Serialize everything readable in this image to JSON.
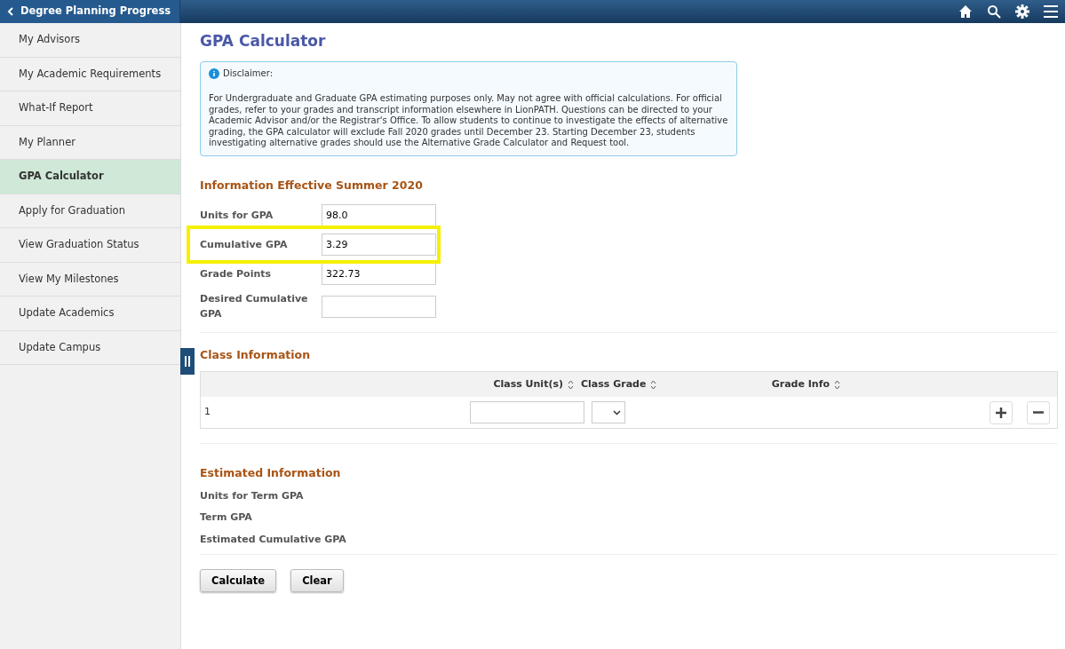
{
  "header": {
    "back_label": "Degree Planning Progress"
  },
  "sidebar": {
    "items": [
      {
        "label": "My Advisors",
        "selected": false
      },
      {
        "label": "My Academic Requirements",
        "selected": false
      },
      {
        "label": "What-If Report",
        "selected": false
      },
      {
        "label": "My Planner",
        "selected": false
      },
      {
        "label": "GPA Calculator",
        "selected": true
      },
      {
        "label": "Apply for Graduation",
        "selected": false
      },
      {
        "label": "View Graduation Status",
        "selected": false
      },
      {
        "label": "View My Milestones",
        "selected": false
      },
      {
        "label": "Update Academics",
        "selected": false
      },
      {
        "label": "Update Campus",
        "selected": false
      }
    ]
  },
  "page_title": "GPA Calculator",
  "disclaimer": {
    "title": "Disclaimer:",
    "text": "For Undergraduate and Graduate GPA estimating purposes only. May not agree with official calculations. For official grades, refer to your grades and transcript information elsewhere in LionPATH. Questions can be directed to your Academic Advisor and/or the Registrar's Office. To allow students to continue to investigate the effects of alternative grading, the GPA calculator will exclude Fall 2020 grades until December 23. Starting December 23, students investigating alternative grades should use the Alternative Grade Calculator and Request tool."
  },
  "info_section": {
    "title": "Information Effective Summer 2020",
    "fields": [
      {
        "label": "Units for GPA",
        "value": "98.0",
        "highlighted": false
      },
      {
        "label": "Cumulative GPA",
        "value": "3.29",
        "highlighted": true
      },
      {
        "label": "Grade Points",
        "value": "322.73",
        "highlighted": false
      },
      {
        "label": "Desired Cumulative GPA",
        "highlighted": false
      }
    ]
  },
  "class_section": {
    "title": "Class Information",
    "columns": [
      "Class Unit(s)",
      "Class Grade",
      "Grade Info"
    ],
    "rows": [
      {
        "number": "1"
      }
    ]
  },
  "estimated_section": {
    "title": "Estimated Information",
    "labels": [
      "Units for Term GPA",
      "Term GPA",
      "Estimated Cumulative GPA"
    ]
  },
  "buttons": [
    "Calculate",
    "Clear"
  ]
}
